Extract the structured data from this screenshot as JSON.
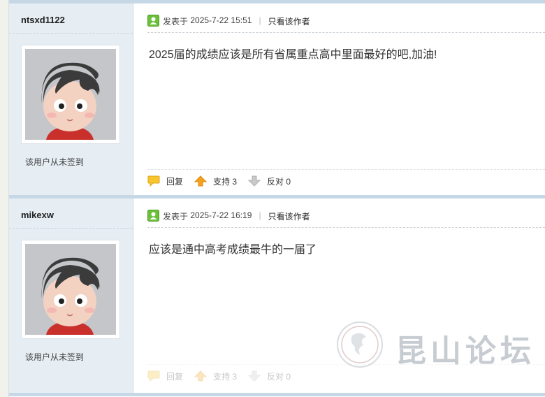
{
  "posts": [
    {
      "username": "ntsxd1122",
      "signin_status": "该用户从未签到",
      "posted_prefix": "发表于",
      "posted_time": "2025-7-22 15:51",
      "author_only": "只看该作者",
      "content": "2025届的成绩应该是所有省属重点高中里面最好的吧,加油!",
      "reply_label": "回复",
      "support_label": "支持 3",
      "oppose_label": "反对 0"
    },
    {
      "username": "mikexw",
      "signin_status": "该用户从未签到",
      "posted_prefix": "发表于",
      "posted_time": "2025-7-22 16:19",
      "author_only": "只看该作者",
      "content": "应该是通中高考成绩最牛的一届了",
      "reply_label": "回复",
      "support_label": "支持 3",
      "oppose_label": "反对 0"
    }
  ],
  "meta_separator": "|",
  "watermark": {
    "text": "昆山论坛"
  },
  "colors": {
    "accent_green": "#6bbf3a",
    "support_orange": "#f5a11b",
    "separator_blue": "#c6d8e5"
  },
  "icons": {
    "post_pin": "green-pin-icon",
    "reply": "speech-bubble-icon",
    "support": "up-arrow-icon",
    "oppose": "down-arrow-icon"
  }
}
